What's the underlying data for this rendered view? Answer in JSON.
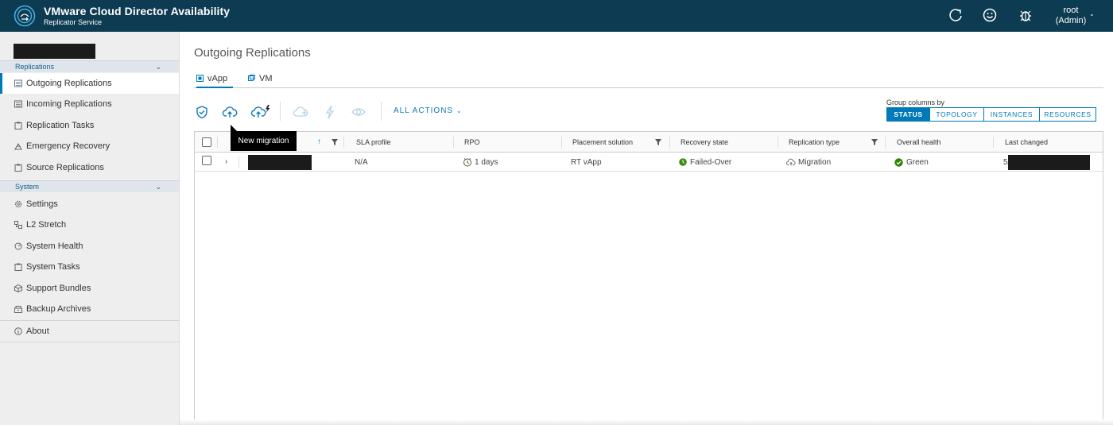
{
  "header": {
    "title": "VMware Cloud Director Availability",
    "subtitle": "Replicator Service",
    "user_name": "root",
    "user_role": "(Admin)",
    "icons": [
      "refresh-icon",
      "smiley-icon",
      "bug-icon"
    ],
    "background": "#0d3b52"
  },
  "sidebar": {
    "sections": [
      {
        "title": "Replications",
        "items": [
          {
            "label": "Outgoing Replications",
            "icon": "list-icon",
            "active": true
          },
          {
            "label": "Incoming Replications",
            "icon": "list-icon"
          },
          {
            "label": "Replication Tasks",
            "icon": "clipboard-icon"
          },
          {
            "label": "Emergency Recovery",
            "icon": "recovery-icon"
          },
          {
            "label": "Source Replications",
            "icon": "clipboard-icon"
          }
        ]
      },
      {
        "title": "System",
        "items": [
          {
            "label": "Settings",
            "icon": "gear-icon"
          },
          {
            "label": "L2 Stretch",
            "icon": "network-icon"
          },
          {
            "label": "System Health",
            "icon": "health-icon"
          },
          {
            "label": "System Tasks",
            "icon": "clipboard-icon"
          },
          {
            "label": "Support Bundles",
            "icon": "bundle-icon"
          },
          {
            "label": "Backup Archives",
            "icon": "archive-icon"
          }
        ]
      }
    ],
    "about": "About"
  },
  "main": {
    "page_title": "Outgoing Replications",
    "tabs": [
      {
        "label": "vApp",
        "active": true
      },
      {
        "label": "VM"
      }
    ],
    "toolbar": {
      "all_actions": "ALL ACTIONS",
      "tooltip": "New migration"
    },
    "group_columns": {
      "label": "Group columns by",
      "options": [
        "STATUS",
        "TOPOLOGY",
        "INSTANCES",
        "RESOURCES"
      ],
      "selected": "STATUS"
    },
    "table": {
      "columns": [
        "SLA profile",
        "RPO",
        "Placement solution",
        "Recovery state",
        "Replication type",
        "Overall health",
        "Last changed"
      ],
      "rows": [
        {
          "sla_profile": "N/A",
          "rpo": "1 days",
          "placement": "RT vApp",
          "recovery_state": "Failed-Over",
          "replication_type": "Migration",
          "overall_health": "Green",
          "last_changed_prefix": "5/"
        }
      ]
    }
  },
  "colors": {
    "accent": "#0079b8",
    "health_green": "#2f8400"
  }
}
